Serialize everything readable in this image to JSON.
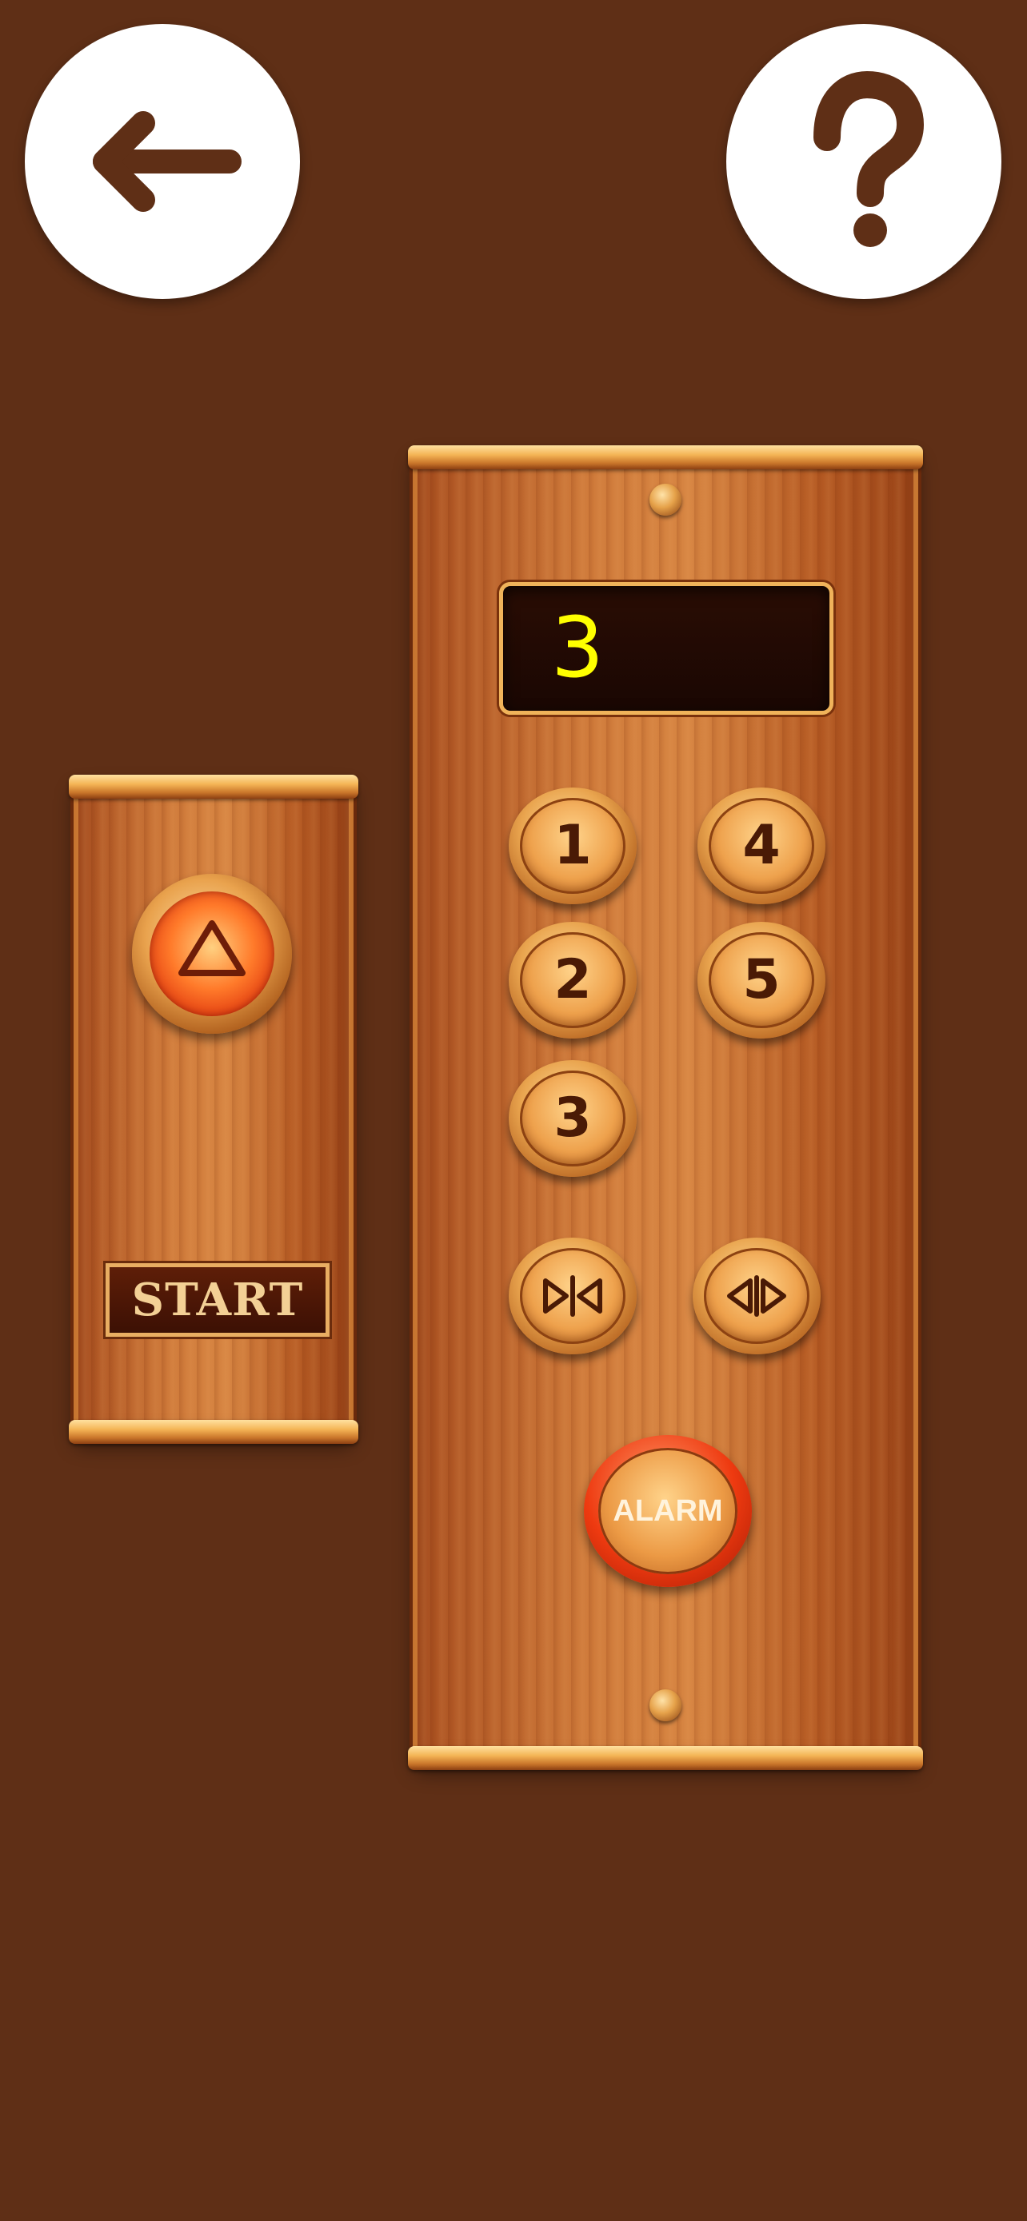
{
  "top_bar": {
    "back_icon": "arrow-left-icon",
    "help_icon": "question-mark-icon"
  },
  "call_panel": {
    "up_icon": "triangle-up-icon",
    "start_label": "START"
  },
  "main_panel": {
    "display_value": "3",
    "floors": [
      "1",
      "2",
      "3",
      "4",
      "5"
    ],
    "door_close_icon": "door-close-icon",
    "door_open_icon": "door-open-icon",
    "alarm_label": "ALARM"
  },
  "colors": {
    "background": "#5f2f16",
    "display_text": "#ffff00",
    "alarm_red": "#ee3a10",
    "brass": "#e9a44e"
  }
}
